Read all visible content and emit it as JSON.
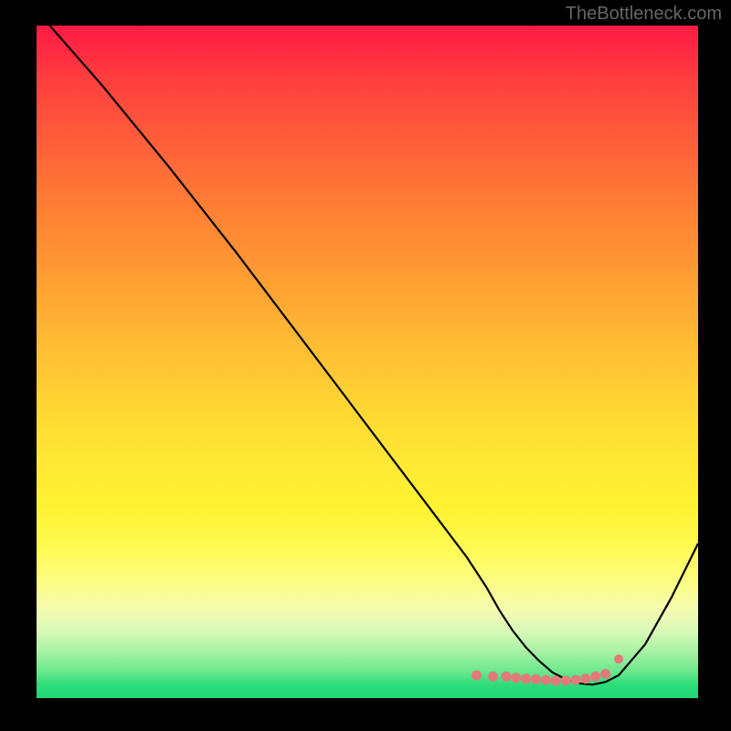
{
  "watermark": "TheBottleneck.com",
  "chart_data": {
    "type": "line",
    "title": "",
    "xlabel": "",
    "ylabel": "",
    "xlim": [
      0,
      100
    ],
    "ylim": [
      0,
      100
    ],
    "series": [
      {
        "name": "curve",
        "x": [
          2,
          10,
          20,
          30,
          40,
          50,
          60,
          65,
          68,
          70,
          72,
          74,
          76,
          78,
          80,
          82,
          84,
          86,
          88,
          92,
          96,
          100
        ],
        "y": [
          100,
          91,
          79,
          66.5,
          53.5,
          40.5,
          27.5,
          21,
          16.5,
          13,
          10,
          7.5,
          5.5,
          3.8,
          2.8,
          2.2,
          2.0,
          2.4,
          3.4,
          8.0,
          15,
          23
        ]
      }
    ],
    "highlight_dots": {
      "x": [
        66.5,
        69,
        71,
        72.5,
        74,
        75.5,
        77,
        78.5,
        80,
        81.5,
        83,
        84.5,
        86,
        88
      ],
      "y": [
        3.4,
        3.2,
        3.2,
        3.0,
        2.9,
        2.8,
        2.7,
        2.6,
        2.6,
        2.7,
        2.9,
        3.2,
        3.6,
        5.8
      ]
    },
    "gradient_colors": [
      "#ff1a44",
      "#ffd433",
      "#fff333",
      "#1dd775"
    ]
  }
}
